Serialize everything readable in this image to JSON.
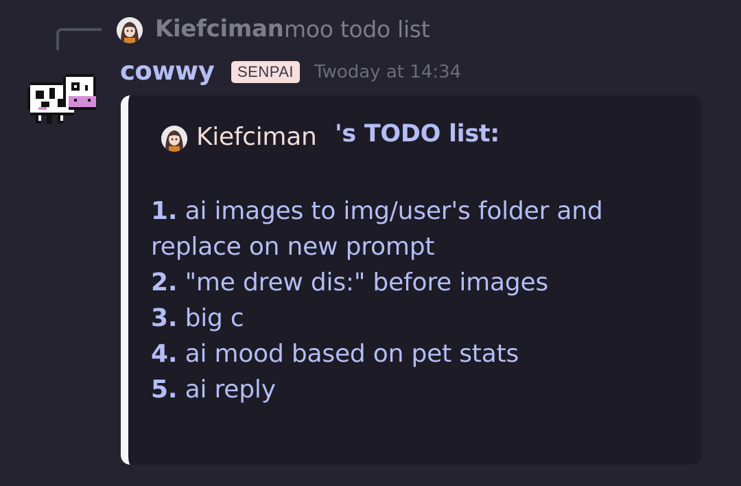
{
  "reply": {
    "author": "Kiefciman",
    "text": "moo todo list",
    "avatar_icon": "anime-girl-avatar-icon"
  },
  "message": {
    "author": "cowwy",
    "author_color": "#b5bdf5",
    "badge": "SENPAI",
    "timestamp": "Twoday at 14:34",
    "avatar_icon": "pixel-cow-icon"
  },
  "embed": {
    "accent_color": "#f6f6f8",
    "header": {
      "name": "Kiefciman",
      "title": "'s TODO list:",
      "avatar_icon": "anime-girl-avatar-icon"
    },
    "items": [
      {
        "num": "1.",
        "text": "ai images to img/user's folder and replace on new prompt"
      },
      {
        "num": "2.",
        "text": "\"me drew dis:\" before images"
      },
      {
        "num": "3.",
        "text": "big c"
      },
      {
        "num": "4.",
        "text": "ai mood based on pet stats"
      },
      {
        "num": "5.",
        "text": "ai reply"
      }
    ]
  }
}
